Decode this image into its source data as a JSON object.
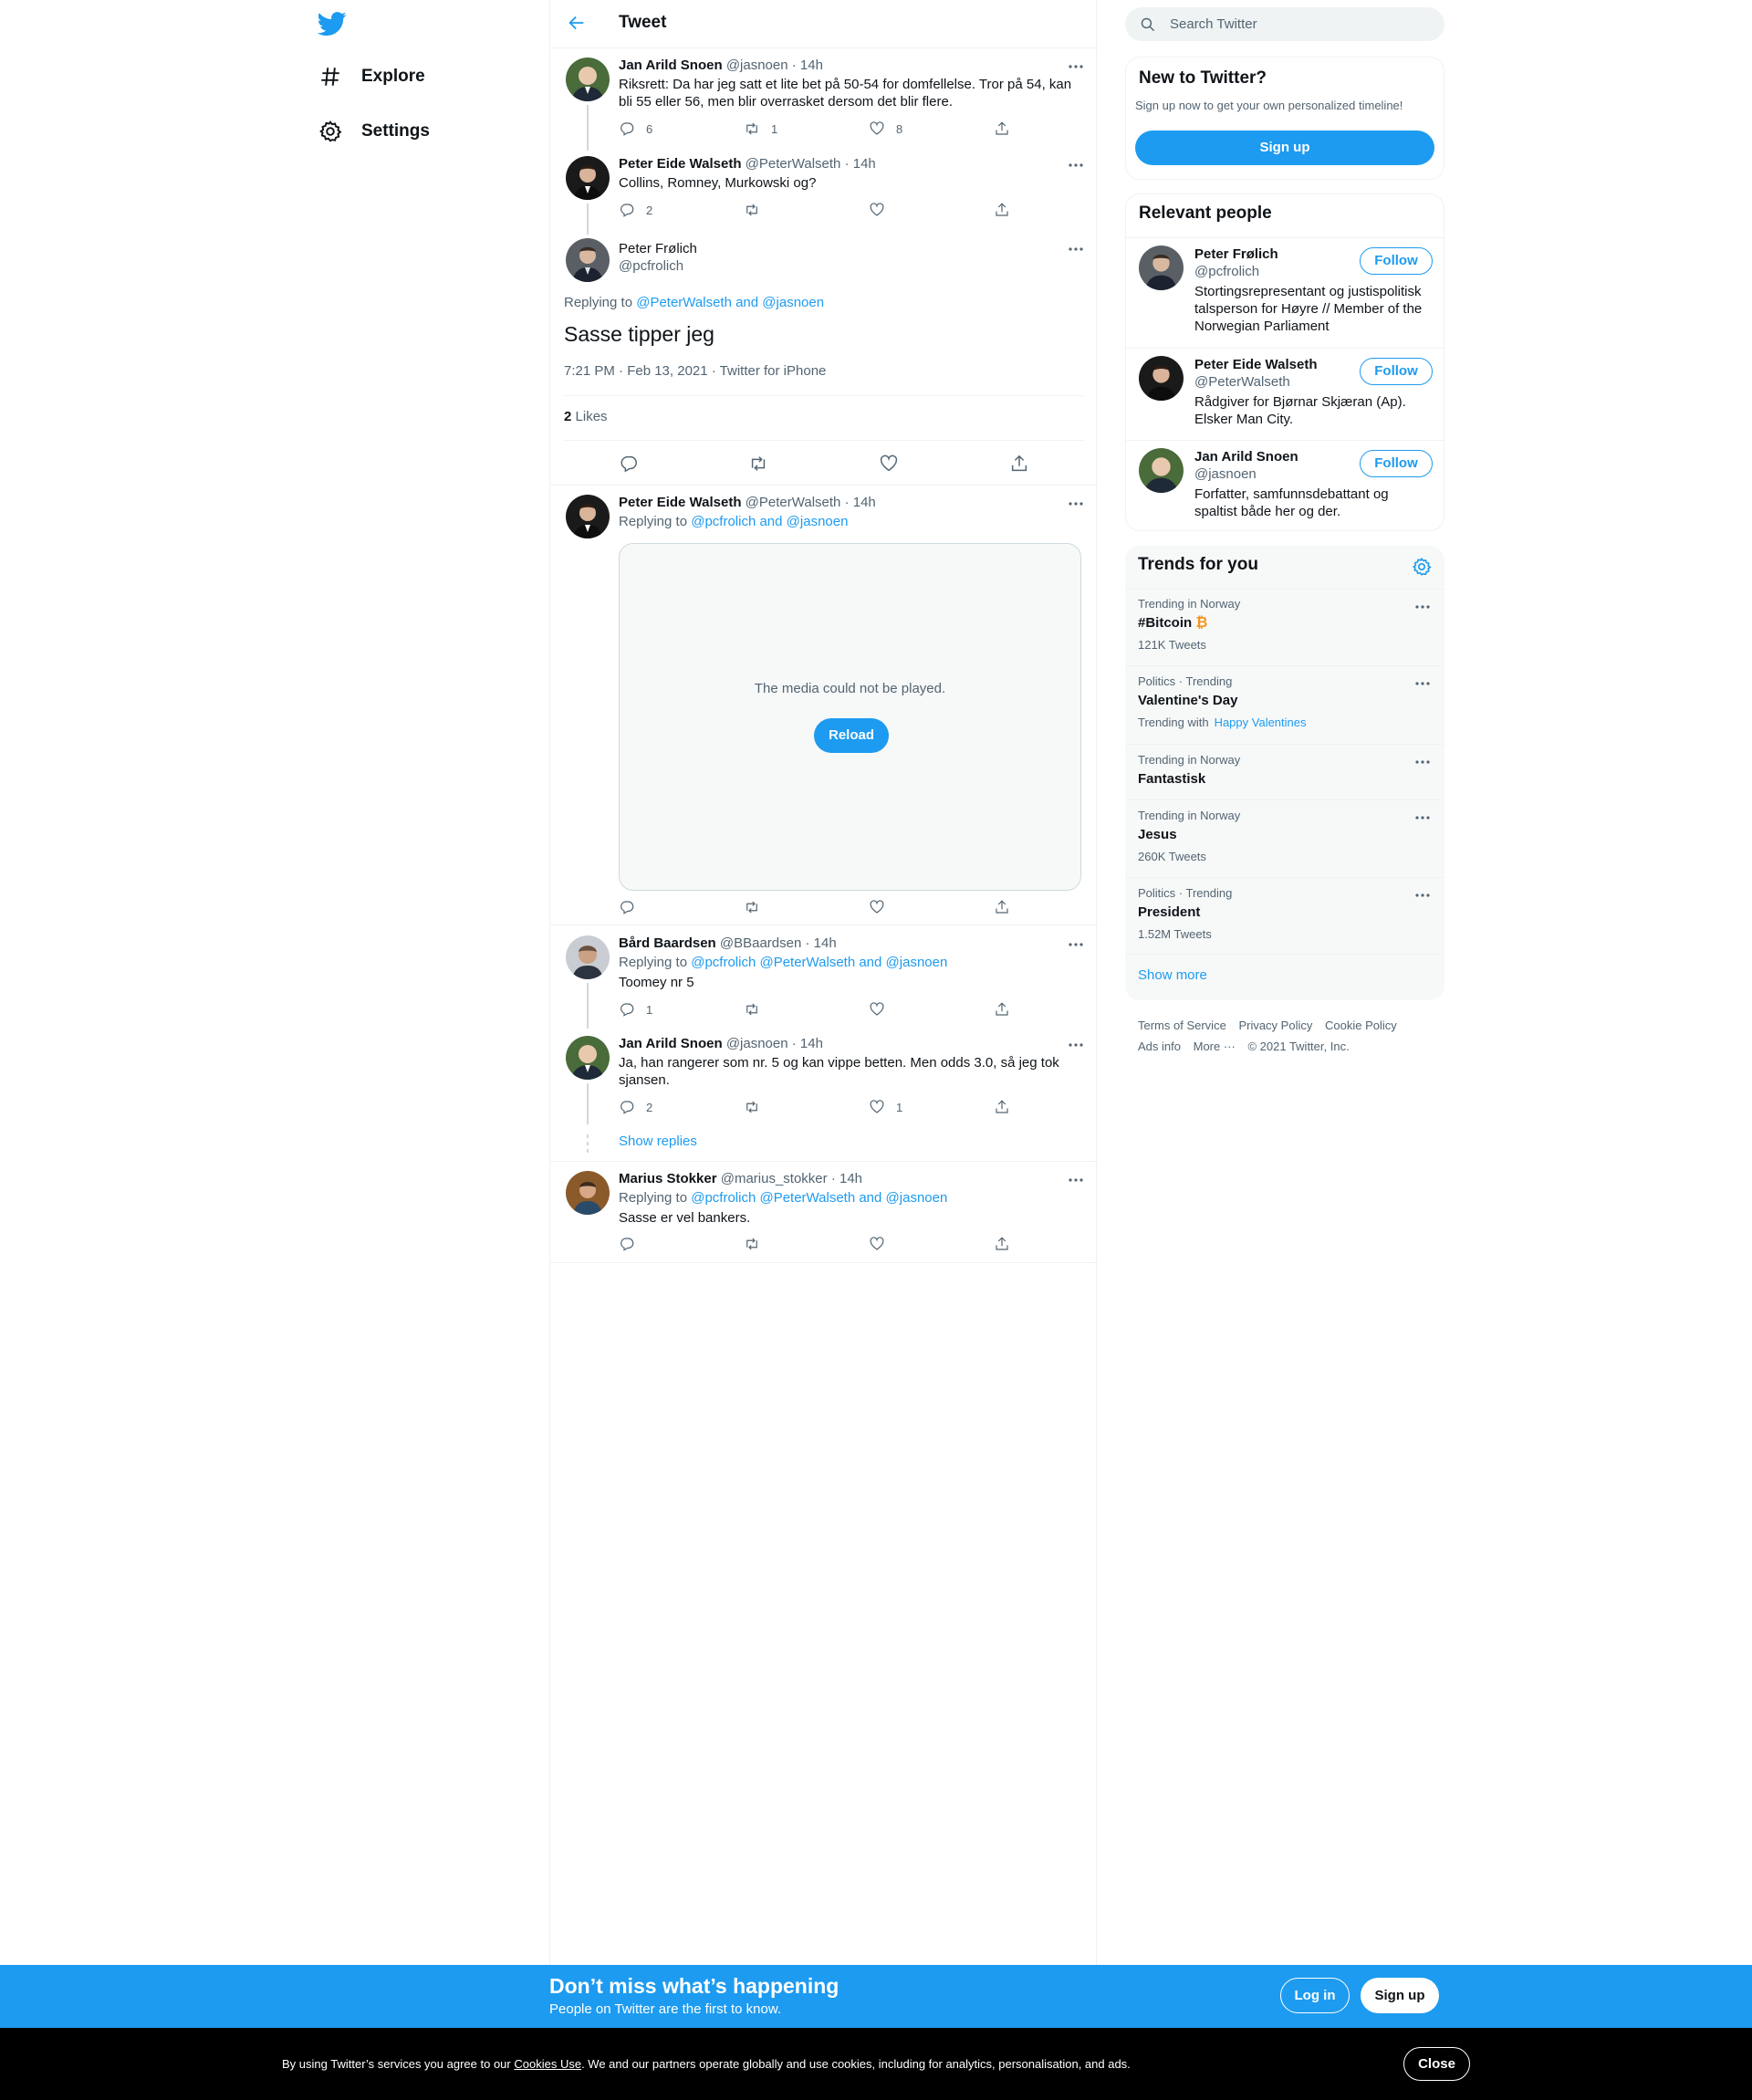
{
  "nav": {
    "items": [
      {
        "label": "Explore",
        "icon": "hashtag-icon"
      },
      {
        "label": "Settings",
        "icon": "gear-icon"
      }
    ]
  },
  "header": {
    "title": "Tweet"
  },
  "thread": {
    "t1": {
      "name": "Jan Arild Snoen",
      "handle": "@jasnoen",
      "time": "· 14h",
      "text": "Riksrett: Da har jeg satt et lite bet på 50-54 for domfellelse. Tror på 54, kan bli 55 eller 56, men blir overrasket dersom det blir flere.",
      "replies": "6",
      "retweets": "1",
      "likes": "8"
    },
    "t2": {
      "name": "Peter Eide Walseth",
      "handle": "@PeterWalseth",
      "time": "· 14h",
      "text": "Collins, Romney, Murkowski og?",
      "replies": "2"
    },
    "main": {
      "name": "Peter Frølich",
      "handle": "@pcfrolich",
      "replying_prefix": "Replying to",
      "replying_to": "@PeterWalseth and @jasnoen",
      "text": "Sasse tipper jeg",
      "meta": "7:21 PM · Feb 13, 2021 · Twitter for iPhone",
      "likes_count": "2",
      "likes_label": "Likes"
    },
    "r1": {
      "name": "Peter Eide Walseth",
      "handle": "@PeterWalseth",
      "time": "· 14h",
      "replying_prefix": "Replying to",
      "replying_to": "@pcfrolich and @jasnoen",
      "media_msg": "The media could not be played.",
      "reload": "Reload"
    },
    "r2": {
      "name": "Bård Baardsen",
      "handle": "@BBaardsen",
      "time": "· 14h",
      "replying_prefix": "Replying to",
      "replying_to": "@pcfrolich @PeterWalseth and @jasnoen",
      "text": "Toomey nr 5",
      "replies": "1"
    },
    "r3": {
      "name": "Jan Arild Snoen",
      "handle": "@jasnoen",
      "time": "· 14h",
      "text": "Ja, han rangerer som nr. 5 og kan vippe betten. Men odds 3.0, så jeg tok sjansen.",
      "replies": "2",
      "likes": "1",
      "show_replies": "Show replies"
    },
    "r4": {
      "name": "Marius Stokker",
      "handle": "@marius_stokker",
      "time": "· 14h",
      "replying_prefix": "Replying to",
      "replying_to": "@pcfrolich @PeterWalseth and @jasnoen",
      "text": "Sasse er vel bankers."
    }
  },
  "search": {
    "placeholder": "Search Twitter"
  },
  "new_to_twitter": {
    "title": "New to Twitter?",
    "subtitle": "Sign up now to get your own personalized timeline!",
    "button": "Sign up"
  },
  "relevant": {
    "title": "Relevant people",
    "follow_label": "Follow",
    "people": [
      {
        "name": "Peter Frølich",
        "handle": "@pcfrolich",
        "bio": "Stortingsrepresentant og justispolitisk talsperson for Høyre // Member of the Norwegian Parliament"
      },
      {
        "name": "Peter Eide Walseth",
        "handle": "@PeterWalseth",
        "bio": "Rådgiver for Bjørnar Skjæran (Ap). Elsker Man City."
      },
      {
        "name": "Jan Arild Snoen",
        "handle": "@jasnoen",
        "bio": "Forfatter, samfunnsdebattant og spaltist både her og der."
      }
    ]
  },
  "trends": {
    "title": "Trends for you",
    "items": [
      {
        "context": "Trending in Norway",
        "name": "#Bitcoin",
        "count": "121K Tweets"
      },
      {
        "context": "Politics · Trending",
        "name": "Valentine's Day",
        "count": "Trending with",
        "with": "Happy Valentines"
      },
      {
        "context": "Trending in Norway",
        "name": "Fantastisk"
      },
      {
        "context": "Trending in Norway",
        "name": "Jesus",
        "count": "260K Tweets"
      },
      {
        "context": "Politics · Trending",
        "name": "President",
        "count": "1.52M Tweets"
      }
    ],
    "show_more": "Show more"
  },
  "footer": {
    "links": [
      "Terms of Service",
      "Privacy Policy",
      "Cookie Policy",
      "Ads info",
      "More ···"
    ],
    "copyright": "© 2021 Twitter, Inc."
  },
  "banner": {
    "title": "Don’t miss what’s happening",
    "subtitle": "People on Twitter are the first to know.",
    "login": "Log in",
    "signup": "Sign up"
  },
  "cookie": {
    "prefix": "By using Twitter’s services you agree to our",
    "link": "Cookies Use",
    "suffix": ". We and our partners operate globally and use cookies, including for analytics, personalisation, and ads.",
    "close": "Close"
  },
  "colors": {
    "accent": "#1d9bf0",
    "text": "#0f1419",
    "secondary": "#536471",
    "border": "#eff3f4",
    "bitcoin": "#f7931a"
  }
}
